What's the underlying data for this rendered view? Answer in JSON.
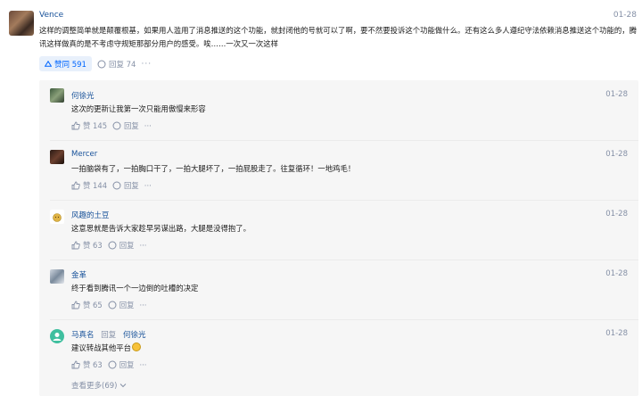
{
  "main_comment": {
    "author": "Vence",
    "date": "01-28",
    "text": "这样的调整简单就是颠覆根基，如果用人滥用了消息推送的这个功能，就封闭他的号就可以了啊，要不然要投诉这个功能做什么。还有这么多人遵纪守法依赖消息推送这个功能的，腾讯这样做真的是不考虑守规矩那部分用户的感受。唉……一次又一次这样",
    "vote_label": "赞同 591",
    "reply_label": "回复 74",
    "more": "···"
  },
  "replies": [
    {
      "author": "何徐光",
      "reply_word": "",
      "reply_to": "",
      "date": "01-28",
      "text": "这次的更新让我第一次只能用傲慢来形容",
      "like_label": "赞 145",
      "reply_label": "回复",
      "more": "···",
      "emoji": false
    },
    {
      "author": "Mercer",
      "reply_word": "",
      "reply_to": "",
      "date": "01-28",
      "text": "一拍脑袋有了，一拍胸口干了，一拍大腿坏了，一拍屁股走了。往复循环！一地鸡毛！",
      "like_label": "赞 144",
      "reply_label": "回复",
      "more": "···",
      "emoji": false
    },
    {
      "author": "风趣的土豆",
      "reply_word": "",
      "reply_to": "",
      "date": "01-28",
      "text": "这意思就是告诉大家趁早另谋出路，大腿是没得抱了。",
      "like_label": "赞 63",
      "reply_label": "回复",
      "more": "···",
      "emoji": false
    },
    {
      "author": "金革",
      "reply_word": "",
      "reply_to": "",
      "date": "01-28",
      "text": "终于看到腾讯一个一边倒的吐槽的决定",
      "like_label": "赞 65",
      "reply_label": "回复",
      "more": "···",
      "emoji": false
    },
    {
      "author": "马真名",
      "reply_word": "回复",
      "reply_to": "何徐光",
      "date": "01-28",
      "text": "建议转战其他平台",
      "like_label": "赞 63",
      "reply_label": "回复",
      "more": "···",
      "emoji": true
    }
  ],
  "see_more": "查看更多(69)",
  "colors": {
    "link": "#175199",
    "meta": "#8590a6",
    "accent": "#0066ff",
    "panel_bg": "#f6f6f6"
  }
}
